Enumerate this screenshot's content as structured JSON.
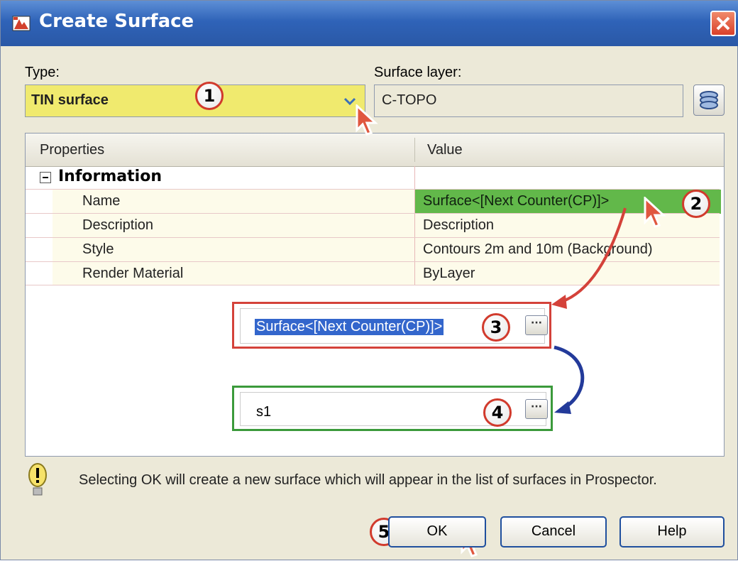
{
  "window": {
    "title": "Create Surface",
    "close_label": "✕"
  },
  "type_field": {
    "label": "Type:",
    "value": "TIN surface"
  },
  "surface_layer": {
    "label": "Surface layer:",
    "value": "C-TOPO"
  },
  "grid": {
    "columns": [
      "Properties",
      "Value"
    ],
    "group": "Information",
    "rows": [
      {
        "name": "Name",
        "value": "Surface<[Next Counter(CP)]>"
      },
      {
        "name": "Description",
        "value": "Description"
      },
      {
        "name": "Style",
        "value": "Contours 2m and 10m (Background)"
      },
      {
        "name": "Render Material",
        "value": "ByLayer"
      }
    ]
  },
  "callouts": {
    "edit_name_selected": "Surface<[Next Counter(CP)]>",
    "edit_name_new": "s1",
    "ellipsis": "···"
  },
  "badges": [
    "1",
    "2",
    "3",
    "4",
    "5"
  ],
  "info_message": "Selecting OK will create a new surface which will appear in the list of surfaces in Prospector.",
  "buttons": {
    "ok": "OK",
    "cancel": "Cancel",
    "help": "Help"
  },
  "colors": {
    "title_bar": "#2f63b8",
    "type_highlight": "#f0ea6e",
    "name_highlight": "#62b84a",
    "callout_red": "#d4423a",
    "callout_green": "#3b9a3b",
    "arrow_blue": "#233a9a"
  },
  "icons": {
    "title": "civil-app-icon",
    "close": "close-icon",
    "dropdown": "chevron-down-icon",
    "layer": "layer-stack-icon",
    "info": "exclamation-bulb-icon",
    "expander": "collapse-minus-icon",
    "cursor": "mouse-pointer-icon"
  }
}
